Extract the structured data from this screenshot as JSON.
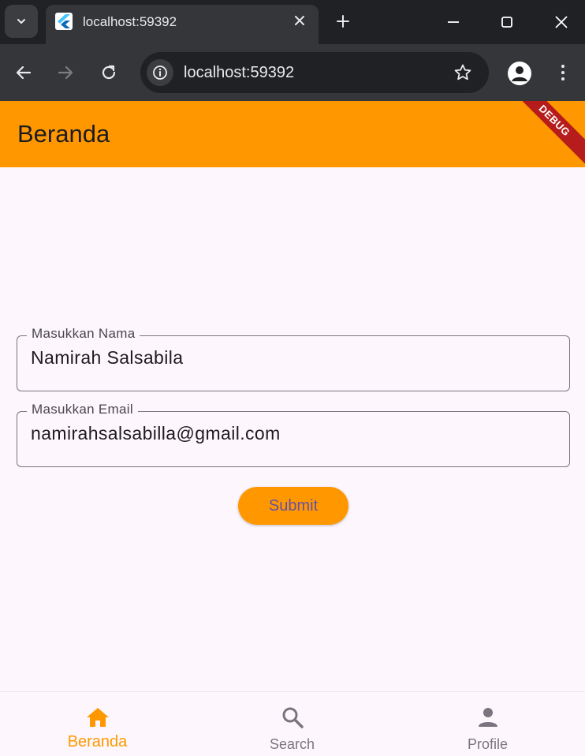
{
  "browser": {
    "tab_title": "localhost:59392",
    "url": "localhost:59392"
  },
  "appbar": {
    "title": "Beranda",
    "debug_label": "DEBUG",
    "color": "#ff9800"
  },
  "form": {
    "name_label": "Masukkan Nama",
    "name_value": "Namirah Salsabila",
    "email_label": "Masukkan Email",
    "email_value": "namirahsalsabilla@gmail.com",
    "submit_label": "Submit"
  },
  "bottom_nav": {
    "items": [
      {
        "label": "Beranda",
        "icon": "home-icon",
        "active": true
      },
      {
        "label": "Search",
        "icon": "search-icon",
        "active": false
      },
      {
        "label": "Profile",
        "icon": "person-icon",
        "active": false
      }
    ],
    "active_color": "#ff9800",
    "inactive_color": "#79747e"
  }
}
